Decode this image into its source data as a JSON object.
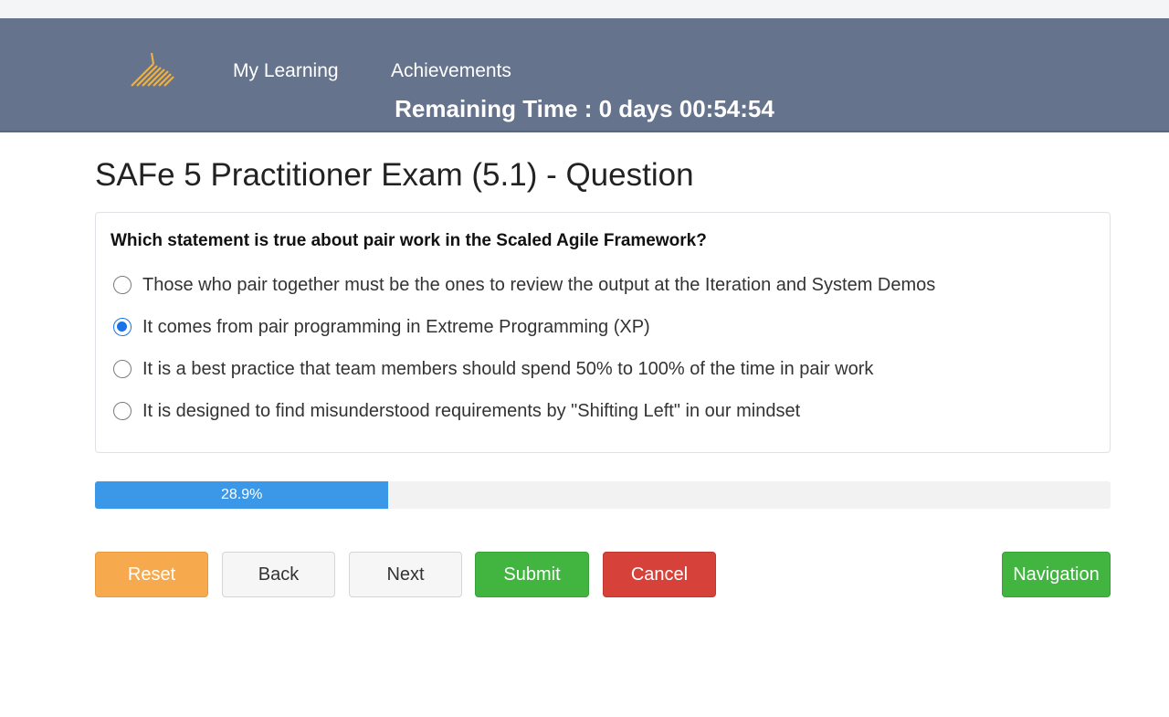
{
  "header": {
    "nav_links": [
      "My Learning",
      "Achievements"
    ],
    "remaining_time": "Remaining Time : 0 days 00:54:54",
    "logo_icon": "striped-triangle-logo-icon",
    "logo_color": "#e9b24c",
    "background_color": "#66738c"
  },
  "exam": {
    "title": "SAFe 5 Practitioner Exam (5.1) - Question",
    "question": "Which statement is true about pair work in the Scaled Agile Framework?",
    "options": [
      "Those who pair together must be the ones to review the output at the Iteration and System Demos",
      "It comes from pair programming in Extreme Programming (XP)",
      "It is a best practice that team members should spend 50% to 100% of the time in pair work",
      "It is designed to find misunderstood requirements by \"Shifting Left\" in our mindset"
    ],
    "selected_option_index": 1
  },
  "progress": {
    "label": "28.9%",
    "value": 28.9
  },
  "buttons": {
    "reset": "Reset",
    "back": "Back",
    "next": "Next",
    "submit": "Submit",
    "cancel": "Cancel",
    "navigation": "Navigation"
  },
  "colors": {
    "reset": "#f7a94d",
    "submit": "#41b53f",
    "cancel": "#d6413a",
    "navigation": "#41b53f",
    "progress_fill": "#3b97e8",
    "radio_selected": "#1a73e8"
  }
}
